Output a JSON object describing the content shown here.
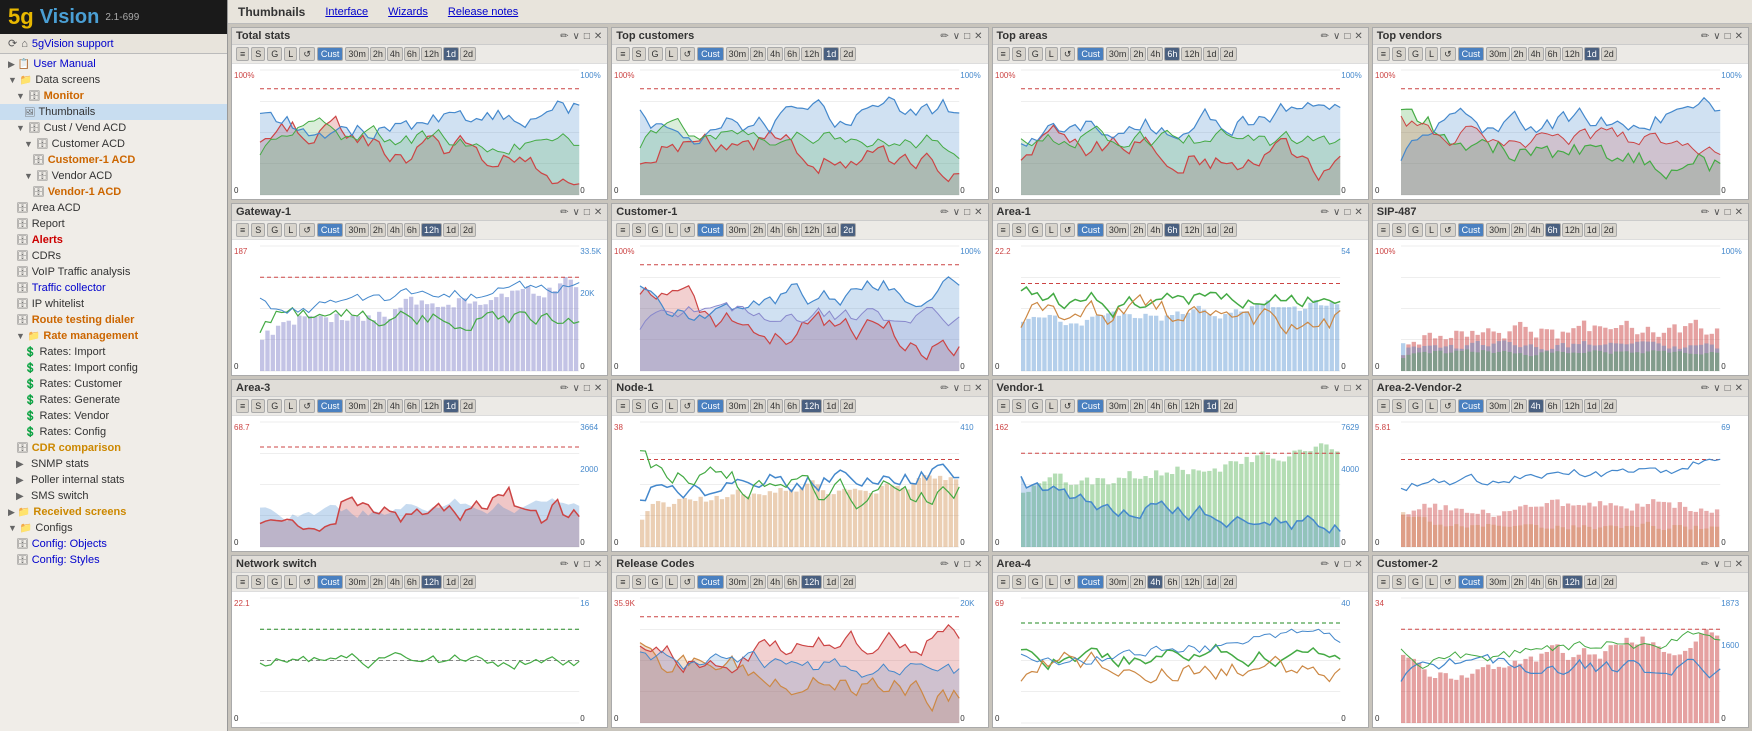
{
  "logo": {
    "prefix": "5g",
    "suffix": "Vision",
    "version": "2.1-699"
  },
  "support": {
    "label": "5gVision support"
  },
  "nav": {
    "title": "Thumbnails",
    "links": [
      "Interface",
      "Wizards",
      "Release notes"
    ]
  },
  "sidebar": {
    "items": [
      {
        "id": "user-manual",
        "label": "User Manual",
        "indent": 0,
        "type": "blue",
        "icon": "📄"
      },
      {
        "id": "data-screens",
        "label": "Data screens",
        "indent": 0,
        "type": "dark",
        "icon": "▶"
      },
      {
        "id": "monitor",
        "label": "Monitor",
        "indent": 1,
        "type": "orange",
        "icon": "🗄"
      },
      {
        "id": "thumbnails",
        "label": "Thumbnails",
        "indent": 2,
        "type": "dark",
        "icon": "🖼"
      },
      {
        "id": "cust-vend-acd",
        "label": "Cust / Vend ACD",
        "indent": 1,
        "type": "dark",
        "icon": "🗄"
      },
      {
        "id": "customer-acd",
        "label": "Customer ACD",
        "indent": 2,
        "type": "dark",
        "icon": "🗄"
      },
      {
        "id": "customer-1-acd",
        "label": "Customer-1 ACD",
        "indent": 3,
        "type": "orange",
        "icon": "🗄"
      },
      {
        "id": "vendor-acd",
        "label": "Vendor ACD",
        "indent": 2,
        "type": "dark",
        "icon": "🗄"
      },
      {
        "id": "vendor-1-acd",
        "label": "Vendor-1 ACD",
        "indent": 3,
        "type": "orange",
        "icon": "🗄"
      },
      {
        "id": "area-acd",
        "label": "Area ACD",
        "indent": 1,
        "type": "dark",
        "icon": "🗄"
      },
      {
        "id": "report",
        "label": "Report",
        "indent": 1,
        "type": "dark",
        "icon": "🗄"
      },
      {
        "id": "alerts",
        "label": "Alerts",
        "indent": 1,
        "type": "red",
        "icon": "🗄"
      },
      {
        "id": "cdrs",
        "label": "CDRs",
        "indent": 1,
        "type": "dark",
        "icon": "🗄"
      },
      {
        "id": "voip-traffic",
        "label": "VoIP Traffic analysis",
        "indent": 1,
        "type": "dark",
        "icon": "🗄"
      },
      {
        "id": "traffic-collector",
        "label": "Traffic collector",
        "indent": 1,
        "type": "blue",
        "icon": "🗄"
      },
      {
        "id": "ip-whitelist",
        "label": "IP whitelist",
        "indent": 1,
        "type": "dark",
        "icon": "🗄"
      },
      {
        "id": "route-testing",
        "label": "Route testing dialer",
        "indent": 1,
        "type": "orange",
        "icon": "🗄"
      },
      {
        "id": "rate-management",
        "label": "Rate management",
        "indent": 1,
        "type": "orange",
        "icon": "▶"
      },
      {
        "id": "rates-import",
        "label": "Rates: Import",
        "indent": 2,
        "type": "dark",
        "icon": "💰"
      },
      {
        "id": "rates-import-config",
        "label": "Rates: Import config",
        "indent": 2,
        "type": "dark",
        "icon": "💰"
      },
      {
        "id": "rates-customer",
        "label": "Rates: Customer",
        "indent": 2,
        "type": "dark",
        "icon": "💰"
      },
      {
        "id": "rates-generate",
        "label": "Rates: Generate",
        "indent": 2,
        "type": "dark",
        "icon": "💰"
      },
      {
        "id": "rates-vendor",
        "label": "Rates: Vendor",
        "indent": 2,
        "type": "dark",
        "icon": "💰"
      },
      {
        "id": "rates-config",
        "label": "Rates: Config",
        "indent": 2,
        "type": "dark",
        "icon": "💰"
      },
      {
        "id": "cdr-comparison",
        "label": "CDR comparison",
        "indent": 1,
        "type": "gold",
        "icon": "🗄"
      },
      {
        "id": "snmp-stats",
        "label": "SNMP stats",
        "indent": 1,
        "type": "dark",
        "icon": "🗄"
      },
      {
        "id": "poller-internal",
        "label": "Poller internal stats",
        "indent": 1,
        "type": "dark",
        "icon": "🗄"
      },
      {
        "id": "sms-switch",
        "label": "SMS switch",
        "indent": 1,
        "type": "dark",
        "icon": "🗄"
      },
      {
        "id": "received-screens",
        "label": "Received screens",
        "indent": 0,
        "type": "gold",
        "icon": "▶"
      },
      {
        "id": "configs",
        "label": "Configs",
        "indent": 0,
        "type": "dark",
        "icon": "▼"
      },
      {
        "id": "config-objects",
        "label": "Config: Objects",
        "indent": 1,
        "type": "blue",
        "icon": "🗄"
      },
      {
        "id": "config-styles",
        "label": "Config: Styles",
        "indent": 1,
        "type": "blue",
        "icon": "🗄"
      }
    ]
  },
  "cards": [
    {
      "title": "Total stats",
      "active_time": "1d",
      "active_ctrl": "Cust"
    },
    {
      "title": "Top customers",
      "active_time": "1d",
      "active_ctrl": "Cust"
    },
    {
      "title": "Top areas",
      "active_time": "6h",
      "active_ctrl": "Cust"
    },
    {
      "title": "Top vendors",
      "active_time": "1d",
      "active_ctrl": "Cust"
    },
    {
      "title": "Gateway-1",
      "active_time": "12h",
      "active_ctrl": "Cust"
    },
    {
      "title": "Customer-1",
      "active_time": "2d",
      "active_ctrl": "Cust"
    },
    {
      "title": "Area-1",
      "active_time": "6h",
      "active_ctrl": "Cust"
    },
    {
      "title": "SIP-487",
      "active_time": "6h",
      "active_ctrl": "Cust"
    },
    {
      "title": "Area-3",
      "active_time": "1d",
      "active_ctrl": "Cust"
    },
    {
      "title": "Node-1",
      "active_time": "12h",
      "active_ctrl": "Cust"
    },
    {
      "title": "Vendor-1",
      "active_time": "1d",
      "active_ctrl": "Cust"
    },
    {
      "title": "Area-2-Vendor-2",
      "active_time": "4h",
      "active_ctrl": "Cust"
    },
    {
      "title": "Network switch",
      "active_time": "12h",
      "active_ctrl": "Cust"
    },
    {
      "title": "Release Codes",
      "active_time": "12h",
      "active_ctrl": "Cust"
    },
    {
      "title": "Area-4",
      "active_time": "4h",
      "active_ctrl": "Cust"
    },
    {
      "title": "Customer-2",
      "active_time": "12h",
      "active_ctrl": "Cust"
    }
  ],
  "time_options": [
    "30m",
    "2h",
    "4h",
    "6h",
    "12h",
    "1d",
    "2d"
  ],
  "ctrl_options": [
    "S",
    "G",
    "L",
    "↺"
  ]
}
